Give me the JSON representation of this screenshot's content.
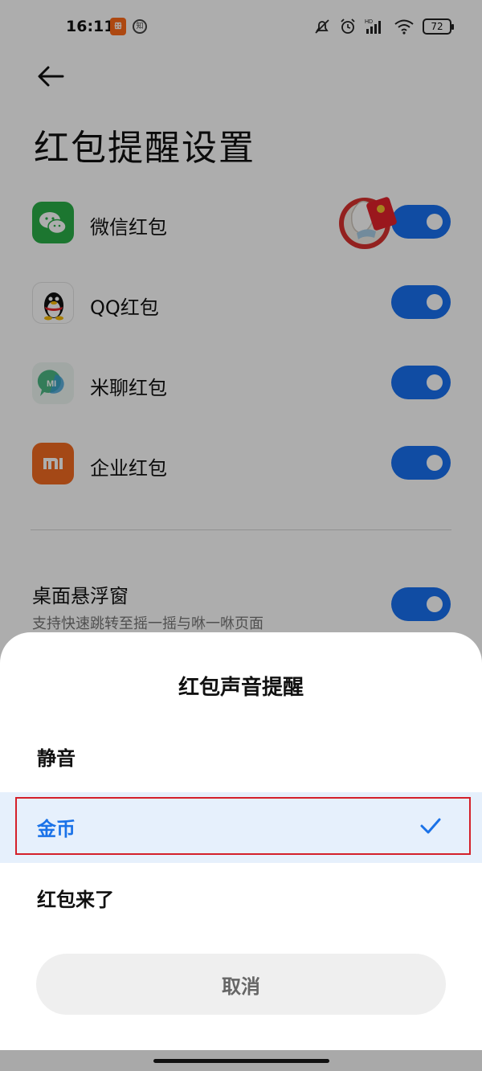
{
  "status_bar": {
    "time": "16:11",
    "app_badge_1": "ꕥ",
    "app_badge_2": "知",
    "battery": "72"
  },
  "page": {
    "title": "红包提醒设置"
  },
  "rows": [
    {
      "label": "微信红包",
      "icon": "wechat-icon",
      "enabled": true
    },
    {
      "label": "QQ红包",
      "icon": "qq-penguin-icon",
      "enabled": true
    },
    {
      "label": "米聊红包",
      "icon": "miliao-icon",
      "enabled": true
    },
    {
      "label": "企业红包",
      "icon": "mi-logo-icon",
      "enabled": true
    }
  ],
  "floating_window": {
    "title": "桌面悬浮窗",
    "subtitle": "支持快速跳转至摇一摇与咻一咻页面",
    "enabled": true
  },
  "sheet": {
    "title": "红包声音提醒",
    "options": [
      {
        "label": "静音",
        "selected": false
      },
      {
        "label": "金币",
        "selected": true
      },
      {
        "label": "红包来了",
        "selected": false
      }
    ],
    "cancel_label": "取消"
  },
  "colors": {
    "accent": "#1971f0",
    "selected_bg": "#e6f0fc",
    "selected_text": "#1a72e8",
    "highlight_border": "#d4202a"
  }
}
